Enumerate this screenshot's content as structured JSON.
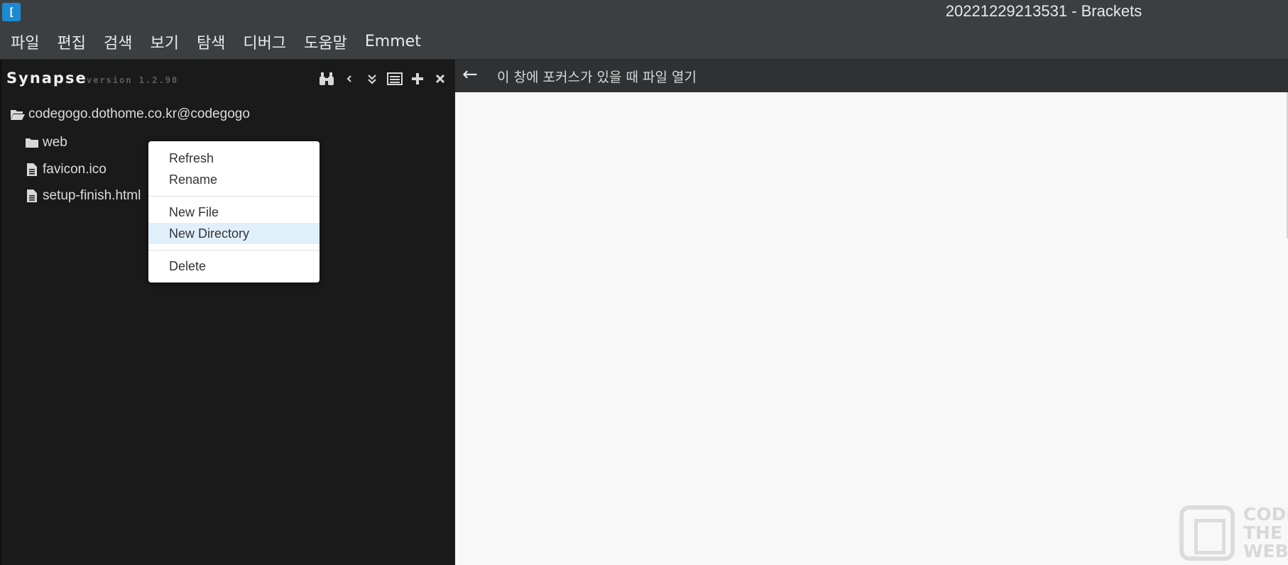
{
  "window": {
    "icon_glyph": "[ ]",
    "title": "20221229213531 - Brackets"
  },
  "menubar": {
    "items": [
      "파일",
      "편집",
      "검색",
      "보기",
      "탐색",
      "디버그",
      "도움말",
      "Emmet"
    ]
  },
  "synapse": {
    "title": "Synapse",
    "version": "version 1.2.90",
    "tool_icons": [
      "binoculars-icon",
      "chevron-left-icon",
      "double-chevron-down-icon",
      "list-icon",
      "plus-icon",
      "close-icon"
    ]
  },
  "tree": {
    "root": "codegogo.dothome.co.kr@codegogo",
    "items": [
      {
        "type": "folder",
        "label": "web"
      },
      {
        "type": "file",
        "label": "favicon.ico"
      },
      {
        "type": "file",
        "label": "setup-finish.html"
      }
    ]
  },
  "context_menu": {
    "groups": [
      [
        "Refresh",
        "Rename"
      ],
      [
        "New File",
        "New Directory"
      ],
      [
        "Delete"
      ]
    ],
    "active": "New Directory"
  },
  "editor": {
    "back_arrow": "←",
    "hint": "이 창에 포커스가 있을 때 파일 열기"
  },
  "watermark": {
    "text": "CODE\nTHE\nWEB"
  },
  "colors": {
    "titlebar": "#3c3f41",
    "sidebar": "#1a1a1a",
    "editor_bg": "#f8f8f8",
    "menu_highlight": "#dff0fb"
  }
}
